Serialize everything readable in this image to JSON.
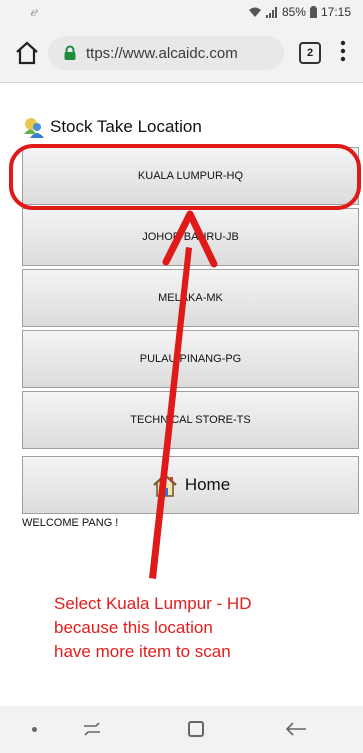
{
  "status": {
    "left_glyph": "ℯ",
    "battery": "85%",
    "time": "17:15"
  },
  "browser": {
    "url": "ttps://www.alcaidc.com",
    "tab_count": "2"
  },
  "page": {
    "title": "Stock Take Location",
    "locations": [
      "KUALA LUMPUR-HQ",
      "JOHOR BAHRU-JB",
      "MELAKA-MK",
      "PULAU PINANG-PG",
      "TECHNICAL STORE-TS"
    ],
    "home_label": "Home",
    "welcome": "WELCOME PANG !"
  },
  "annotation": {
    "lines": [
      "Select Kuala Lumpur - HD",
      "because this location",
      "have more item to scan"
    ],
    "color": "#e21d1d"
  }
}
